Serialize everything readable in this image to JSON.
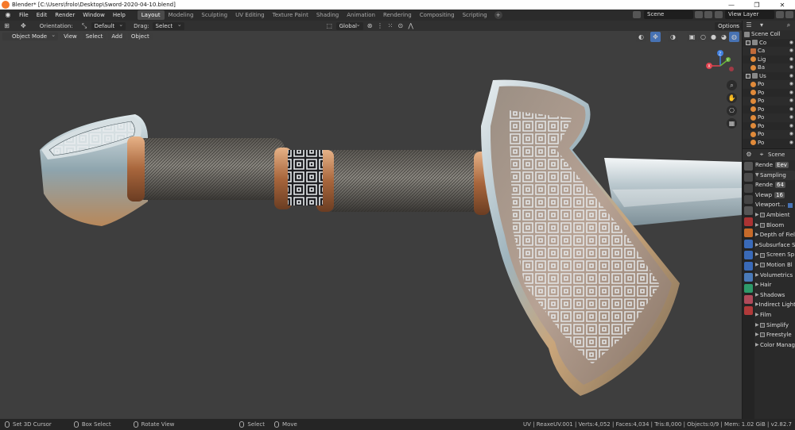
{
  "window": {
    "title": "Blender* [C:\\Users\\frolo\\Desktop\\Sword-2020-04-10.blend]",
    "controls": [
      "—",
      "❐",
      "✕"
    ]
  },
  "menu": [
    "File",
    "Edit",
    "Render",
    "Window",
    "Help"
  ],
  "workspaces": [
    "Layout",
    "Modeling",
    "Sculpting",
    "UV Editing",
    "Texture Paint",
    "Shading",
    "Animation",
    "Rendering",
    "Compositing",
    "Scripting"
  ],
  "workspace_add": "+",
  "scene_field": "Scene",
  "view_layer_field": "View Layer",
  "toolbar": {
    "orientation_label": "Orientation:",
    "orientation_value": "Default",
    "drag_label": "Drag:",
    "drag_value": "Select Box",
    "transform_value": "Global",
    "options_label": "Options"
  },
  "header": {
    "mode": "Object Mode",
    "view": "View",
    "select": "Select",
    "add": "Add",
    "object": "Object"
  },
  "gizmo": {
    "x": "X",
    "y": "Y",
    "z": "Z"
  },
  "outliner": {
    "title": "Scene Coll",
    "rows": [
      {
        "label": "Co",
        "icon": "collection"
      },
      {
        "label": "Ca",
        "icon": "camera"
      },
      {
        "label": "Lig",
        "icon": "light"
      },
      {
        "label": "Ba",
        "icon": "object"
      },
      {
        "label": "Us",
        "icon": "collection"
      },
      {
        "label": "Po",
        "icon": "object"
      },
      {
        "label": "Po",
        "icon": "object"
      },
      {
        "label": "Po",
        "icon": "object"
      },
      {
        "label": "Po",
        "icon": "object"
      },
      {
        "label": "Po",
        "icon": "object"
      },
      {
        "label": "Po",
        "icon": "object"
      },
      {
        "label": "Po",
        "icon": "object"
      },
      {
        "label": "Po",
        "icon": "object"
      }
    ]
  },
  "properties": {
    "scene": "Scene",
    "render_engine_label": "Rende",
    "render_engine_value": "Eev",
    "sampling": "Sampling",
    "render_label": "Rende",
    "render_value": "64",
    "viewport_label": "Viewp",
    "viewport_value": "16",
    "viewport_denoise": "Viewport...",
    "sections": [
      {
        "label": "Ambient",
        "checkbox": true
      },
      {
        "label": "Bloom",
        "checkbox": true
      },
      {
        "label": "Depth of Fiel",
        "checkbox": false
      },
      {
        "label": "Subsurface S",
        "checkbox": false
      },
      {
        "label": "Screen Sp",
        "checkbox": true
      },
      {
        "label": "Motion Bl",
        "checkbox": true
      },
      {
        "label": "Volumetrics",
        "checkbox": false
      },
      {
        "label": "Hair",
        "checkbox": false
      },
      {
        "label": "Shadows",
        "checkbox": false
      },
      {
        "label": "Indirect Lighti",
        "checkbox": false
      },
      {
        "label": "Film",
        "checkbox": false
      },
      {
        "label": "Simplify",
        "checkbox": true
      },
      {
        "label": "Freestyle",
        "checkbox": true
      },
      {
        "label": "Color Manag",
        "checkbox": false
      }
    ]
  },
  "status": {
    "set_cursor": "Set 3D Cursor",
    "box_select": "Box Select",
    "rotate_view": "Rotate View",
    "select": "Select",
    "move": "Move",
    "stats": "UV | ReaxeUV.001 | Verts:4,052 | Faces:4,034 | Tris:8,000 | Objects:0/9 | Mem: 1.02 GiB | v2.82.7"
  }
}
